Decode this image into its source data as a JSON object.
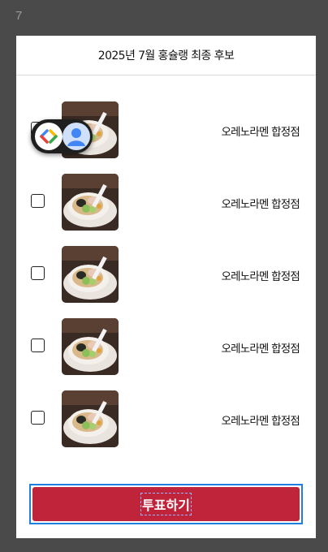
{
  "corner_number": "7",
  "modal": {
    "title": "2025년 7월 홍슐랭 최종 후보"
  },
  "items": [
    {
      "label": "오레노라멘 합정점",
      "image": "ramen-bowl-photo",
      "checked": false
    },
    {
      "label": "오레노라멘 합정점",
      "image": "ramen-bowl-photo",
      "checked": false
    },
    {
      "label": "오레노라멘 합정점",
      "image": "ramen-bowl-photo",
      "checked": false
    },
    {
      "label": "오레노라멘 합정점",
      "image": "ramen-bowl-photo",
      "checked": false
    },
    {
      "label": "오레노라멘 합정점",
      "image": "ramen-bowl-photo",
      "checked": false
    }
  ],
  "vote_button": {
    "label": "투표하기",
    "color": "#c0243a",
    "focus_ring_color": "#1f7fe0"
  },
  "extension_badge": {
    "icons": [
      "code-brackets-icon",
      "profile-icon"
    ]
  }
}
